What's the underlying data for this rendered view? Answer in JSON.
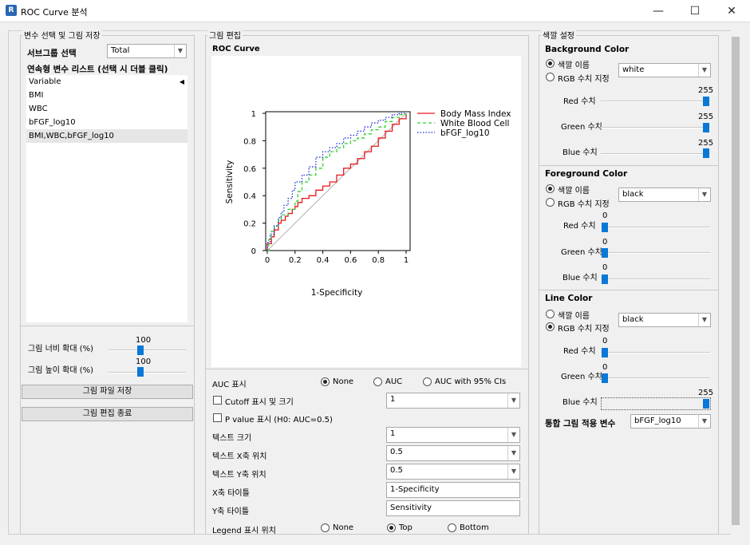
{
  "window": {
    "title": "ROC Curve 분석",
    "icon_letter": "R",
    "min_glyph": "—",
    "max_glyph": "☐",
    "close_glyph": "✕"
  },
  "left": {
    "group_title": "변수 선택 및 그림 저장",
    "subgroup_label": "서브그룹 선택",
    "subgroup_value": "Total",
    "list_title": "연속형 변수 리스트 (선택 시 더블 클릭)",
    "list_items": [
      "Variable",
      "BMI",
      "WBC",
      "bFGF_log10",
      "BMI,WBC,bFGF_log10"
    ],
    "width_label": "그림 너비 확대 (%)",
    "width_value": "100",
    "width_level": 100,
    "height_label": "그림 높이 확대 (%)",
    "height_value": "100",
    "height_level": 100,
    "save_button": "그림 파일 저장",
    "end_button": "그림 편집 종료"
  },
  "middle": {
    "group_title": "그림 편집",
    "plot_title": "ROC Curve",
    "auc_label": "AUC 표시",
    "auc_options": [
      "None",
      "AUC",
      "AUC with  95% CIs"
    ],
    "auc_selected": "None",
    "cutoff_label": "Cutoff 표시 및 크기",
    "cutoff_value": "1",
    "pvalue_label": "P value 표시 (H0: AUC=0.5)",
    "text_size_label": "텍스트 크기",
    "text_size_value": "1",
    "text_x_label": "텍스트 X축 위치",
    "text_x_value": "0.5",
    "text_y_label": "텍스트 Y축 위치",
    "text_y_value": "0.5",
    "xtitle_label": "X축 타이틀",
    "xtitle_value": "1-Specificity",
    "ytitle_label": "Y축 타이틀",
    "ytitle_value": "Sensitivity",
    "legend_label": "Legend 표시 위치",
    "legend_options": [
      "None",
      "Top",
      "Bottom"
    ],
    "legend_selected": "Top"
  },
  "right": {
    "group_title": "색깔 설정",
    "name_option": "색깔 이름",
    "rgb_option": "RGB 수치 지정",
    "red_label": "Red 수치",
    "green_label": "Green 수치",
    "blue_label": "Blue 수치",
    "background": {
      "title": "Background Color",
      "mode": "name",
      "color_name": "white",
      "r": "255",
      "g": "255",
      "b": "255"
    },
    "foreground": {
      "title": "Foreground Color",
      "mode": "name",
      "color_name": "black",
      "r": "0",
      "g": "0",
      "b": "0"
    },
    "line": {
      "title": "Line Color",
      "mode": "rgb",
      "color_name": "black",
      "r": "0",
      "g": "0",
      "b": "255"
    },
    "unified_label": "통합 그림 적용 변수",
    "unified_value": "bFGF_log10"
  },
  "colors": {
    "accent": "#0a78d7",
    "series_bmi": "#e8191d",
    "series_wbc": "#2fce2f",
    "series_bfgf": "#1a2ed6",
    "diagonal": "#b0b0b0"
  },
  "chart_data": {
    "type": "line",
    "title": "",
    "xlabel": "1-Specificity",
    "ylabel": "Sensitivity",
    "xlim": [
      0,
      1
    ],
    "ylim": [
      0,
      1
    ],
    "x_ticks": [
      "0",
      "0.2",
      "0.4",
      "0.6",
      "0.8",
      "1"
    ],
    "y_ticks": [
      "0",
      "0.2",
      "0.4",
      "0.6",
      "0.8",
      "1"
    ],
    "legend_position": "top-right",
    "series": [
      {
        "name": "Body Mass Index",
        "style": "solid",
        "points": [
          [
            0,
            0
          ],
          [
            0,
            0.05
          ],
          [
            0.03,
            0.1
          ],
          [
            0.05,
            0.15
          ],
          [
            0.08,
            0.2
          ],
          [
            0.1,
            0.22
          ],
          [
            0.13,
            0.25
          ],
          [
            0.15,
            0.27
          ],
          [
            0.18,
            0.3
          ],
          [
            0.2,
            0.32
          ],
          [
            0.22,
            0.35
          ],
          [
            0.25,
            0.38
          ],
          [
            0.3,
            0.4
          ],
          [
            0.35,
            0.44
          ],
          [
            0.4,
            0.47
          ],
          [
            0.45,
            0.5
          ],
          [
            0.5,
            0.55
          ],
          [
            0.55,
            0.6
          ],
          [
            0.6,
            0.63
          ],
          [
            0.65,
            0.67
          ],
          [
            0.7,
            0.72
          ],
          [
            0.75,
            0.76
          ],
          [
            0.8,
            0.82
          ],
          [
            0.85,
            0.87
          ],
          [
            0.9,
            0.92
          ],
          [
            0.95,
            0.96
          ],
          [
            1,
            1
          ]
        ]
      },
      {
        "name": "White Blood Cell",
        "style": "dashed",
        "points": [
          [
            0,
            0
          ],
          [
            0.01,
            0.08
          ],
          [
            0.03,
            0.14
          ],
          [
            0.05,
            0.18
          ],
          [
            0.08,
            0.22
          ],
          [
            0.1,
            0.26
          ],
          [
            0.15,
            0.3
          ],
          [
            0.2,
            0.36
          ],
          [
            0.22,
            0.43
          ],
          [
            0.25,
            0.5
          ],
          [
            0.3,
            0.55
          ],
          [
            0.35,
            0.6
          ],
          [
            0.4,
            0.68
          ],
          [
            0.45,
            0.72
          ],
          [
            0.5,
            0.75
          ],
          [
            0.55,
            0.78
          ],
          [
            0.6,
            0.8
          ],
          [
            0.65,
            0.82
          ],
          [
            0.7,
            0.85
          ],
          [
            0.75,
            0.88
          ],
          [
            0.8,
            0.9
          ],
          [
            0.85,
            0.94
          ],
          [
            0.9,
            0.97
          ],
          [
            0.95,
            0.99
          ],
          [
            1,
            1
          ]
        ]
      },
      {
        "name": "bFGF_log10",
        "style": "dotted",
        "points": [
          [
            0,
            0
          ],
          [
            0,
            0.06
          ],
          [
            0.02,
            0.12
          ],
          [
            0.05,
            0.18
          ],
          [
            0.08,
            0.24
          ],
          [
            0.1,
            0.28
          ],
          [
            0.12,
            0.33
          ],
          [
            0.15,
            0.38
          ],
          [
            0.18,
            0.44
          ],
          [
            0.2,
            0.5
          ],
          [
            0.25,
            0.55
          ],
          [
            0.3,
            0.61
          ],
          [
            0.35,
            0.68
          ],
          [
            0.4,
            0.72
          ],
          [
            0.45,
            0.75
          ],
          [
            0.5,
            0.78
          ],
          [
            0.55,
            0.82
          ],
          [
            0.6,
            0.84
          ],
          [
            0.65,
            0.87
          ],
          [
            0.7,
            0.9
          ],
          [
            0.75,
            0.93
          ],
          [
            0.8,
            0.95
          ],
          [
            0.85,
            0.97
          ],
          [
            0.9,
            0.99
          ],
          [
            0.95,
            1
          ],
          [
            1,
            1
          ]
        ]
      }
    ]
  }
}
